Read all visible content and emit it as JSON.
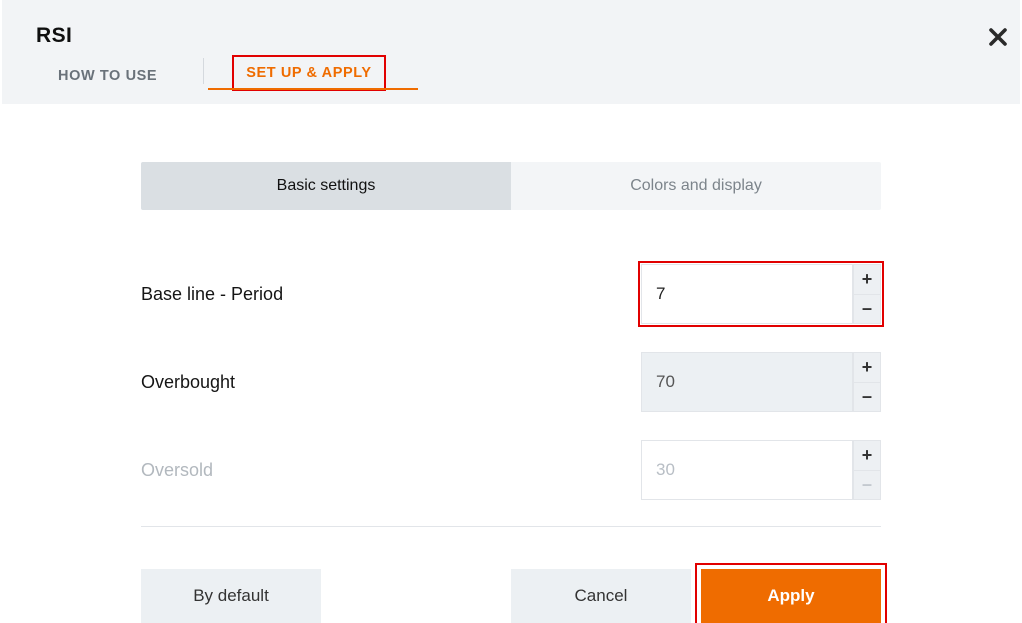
{
  "header": {
    "title": "RSI",
    "close_icon": "✕",
    "nav": {
      "how_to_use": "HOW TO USE",
      "set_up_apply": "SET UP & APPLY"
    }
  },
  "segmented": {
    "basic": "Basic settings",
    "colors": "Colors and display"
  },
  "settings": {
    "baseline": {
      "label": "Base line - Period",
      "value": "7"
    },
    "overbought": {
      "label": "Overbought",
      "value": "70"
    },
    "oversold": {
      "label": "Oversold",
      "value": "30"
    }
  },
  "steppers": {
    "plus": "+",
    "minus": "–"
  },
  "footer": {
    "default": "By default",
    "cancel": "Cancel",
    "apply": "Apply"
  }
}
